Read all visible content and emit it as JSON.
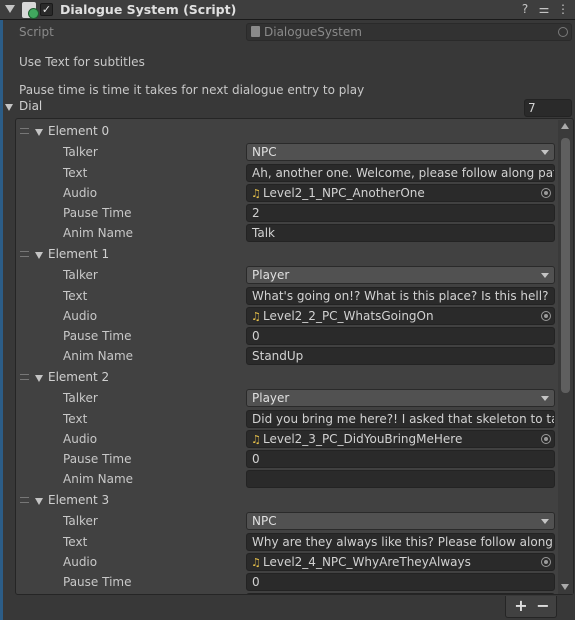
{
  "component": {
    "title": "Dialogue System (Script)",
    "enabled": true,
    "icons": [
      "help-icon",
      "preset-icon",
      "menu-icon"
    ]
  },
  "script": {
    "label": "Script",
    "value": "DialogueSystem"
  },
  "notes": {
    "line1": "Use Text for subtitles",
    "line2": "Pause time is time it takes for next dialogue entry to play"
  },
  "list": {
    "label": "Dial",
    "size": "7",
    "field_labels": {
      "talker": "Talker",
      "text": "Text",
      "audio": "Audio",
      "pause": "Pause Time",
      "anim": "Anim Name"
    },
    "elements": [
      {
        "name": "Element 0",
        "talker": "NPC",
        "text": "Ah, another one. Welcome, please follow along path",
        "audio": "Level2_1_NPC_AnotherOne",
        "pause": "2",
        "anim": "Talk"
      },
      {
        "name": "Element 1",
        "talker": "Player",
        "text": "What's going on!? What is this place? Is this hell?",
        "audio": "Level2_2_PC_WhatsGoingOn",
        "pause": "0",
        "anim": "StandUp"
      },
      {
        "name": "Element 2",
        "talker": "Player",
        "text": "Did you bring me here?! I asked that skeleton to take",
        "audio": "Level2_3_PC_DidYouBringMeHere",
        "pause": "0",
        "anim": ""
      },
      {
        "name": "Element 3",
        "talker": "NPC",
        "text": "Why are they always like this? Please follow along th",
        "audio": "Level2_4_NPC_WhyAreTheyAlways",
        "pause": "0",
        "anim": ""
      }
    ],
    "add_label": "+",
    "remove_label": "−"
  }
}
